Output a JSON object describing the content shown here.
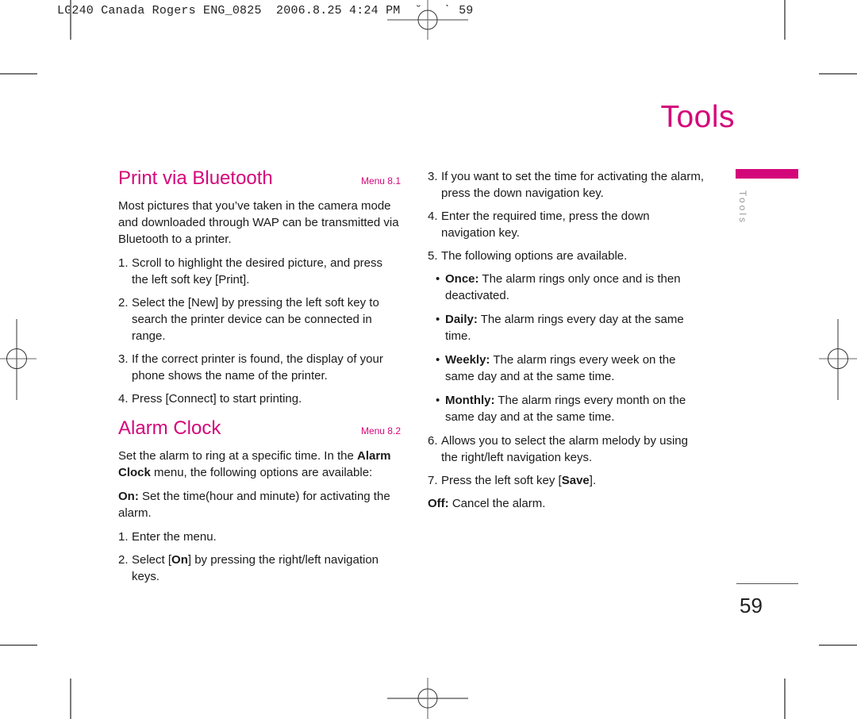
{
  "slug": {
    "text": "LG240 Canada Rogers ENG_0825  2006.8.25 4:24 PM  ˘   ˋ 59"
  },
  "chapter": {
    "title": "Tools",
    "tab_label": "Tools",
    "accent_color": "#d4077a"
  },
  "print_bluetooth": {
    "title": "Print via Bluetooth",
    "menu_ref": "Menu 8.1",
    "intro": "Most pictures that you’ve taken in the camera mode and downloaded through WAP can be transmitted via Bluetooth to a printer.",
    "steps": [
      {
        "num": "1.",
        "text": "Scroll to highlight the desired picture, and press the left soft key [Print]."
      },
      {
        "num": "2.",
        "text": "Select the [New] by pressing the left soft key to search the printer device can be connected in range."
      },
      {
        "num": "3.",
        "text": "If the correct printer is found, the display of your phone shows the name of the printer."
      },
      {
        "num": "4.",
        "text": "Press [Connect] to start printing."
      }
    ]
  },
  "alarm_clock": {
    "title": "Alarm Clock",
    "menu_ref": "Menu 8.2",
    "intro_pre": "Set the alarm to ring at a specific time. In the ",
    "intro_bold1": "Alarm",
    "intro_bold2": "Clock",
    "intro_post": " menu, the following options are available:",
    "on_label": "On:",
    "on_text": " Set the time(hour and minute) for activating the alarm.",
    "steps": [
      {
        "num": "1.",
        "text": "Enter the menu."
      },
      {
        "num": "2.",
        "pre": "Select [",
        "bold": "On",
        "post": "] by pressing the right/left navigation keys."
      },
      {
        "num": "3.",
        "text": "If you want to set the time for activating the alarm, press the down navigation key."
      },
      {
        "num": "4.",
        "text": "Enter the required time, press the down navigation key."
      },
      {
        "num": "5.",
        "text": "The following options are available."
      },
      {
        "num": "6.",
        "text": "Allows you to select the alarm melody by using the right/left navigation keys."
      },
      {
        "num": "7.",
        "pre": "Press the left soft key [",
        "bold": "Save",
        "post": "]."
      }
    ],
    "options": [
      {
        "label": "Once:",
        "text": " The alarm rings only once and is then deactivated."
      },
      {
        "label": "Daily:",
        "text": " The alarm rings every day at the same time."
      },
      {
        "label": "Weekly:",
        "text": " The alarm rings every week on the same day and at the same time."
      },
      {
        "label": "Monthly:",
        "text": " The alarm rings every month on the same day and at the same time."
      }
    ],
    "bullet_char": "•",
    "off_label": "Off:",
    "off_text": " Cancel the alarm."
  },
  "footer": {
    "page_number": "59"
  }
}
